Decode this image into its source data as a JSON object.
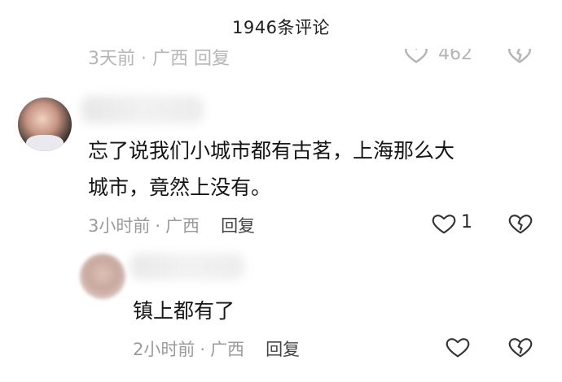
{
  "header": {
    "title": "1946条评论"
  },
  "previous_comment": {
    "meta_text": "3天前 · 广西   回复",
    "like_count": "462"
  },
  "comments": [
    {
      "text": "忘了说我们小城市都有古茗，上海那么大\n城市，竟然上没有。",
      "time": "3小时前",
      "separator": "·",
      "location": "广西",
      "reply_label": "回复",
      "like_count": "1"
    },
    {
      "text": "镇上都有了",
      "time": "2小时前",
      "separator": "·",
      "location": "广西",
      "reply_label": "回复",
      "like_count": ""
    }
  ],
  "icons": {
    "like": "heart-outline-icon",
    "dislike": "broken-heart-icon"
  },
  "colors": {
    "text": "#161616",
    "meta": "#9b9b9b",
    "reply": "#444444"
  }
}
